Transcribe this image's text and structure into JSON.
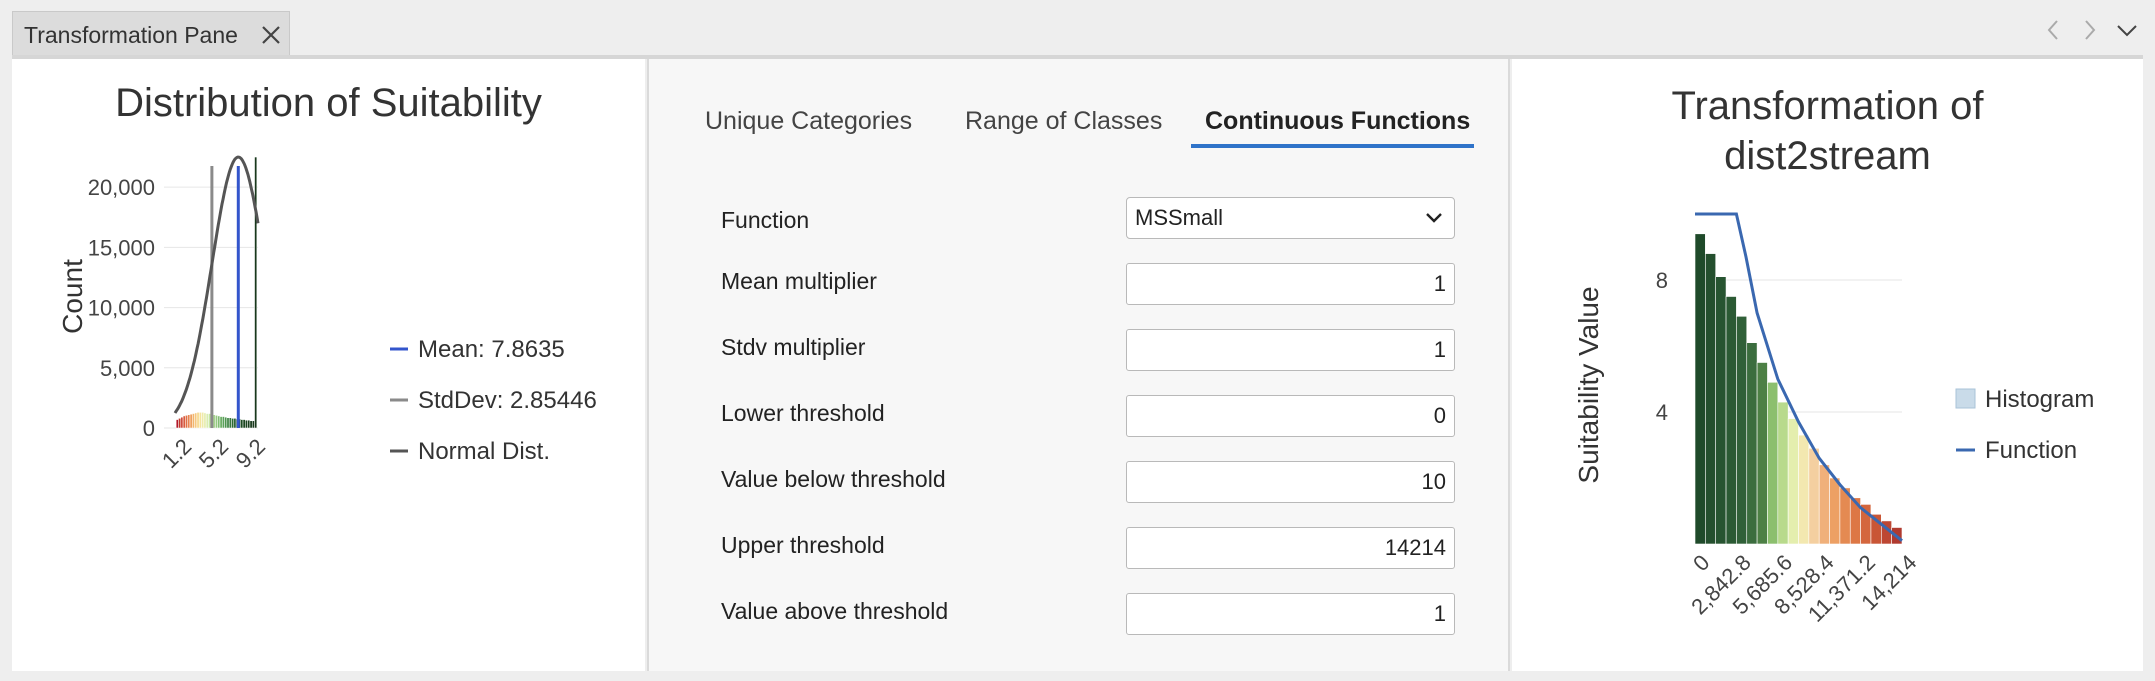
{
  "tab": {
    "title": "Transformation Pane"
  },
  "left_panel": {
    "title": "Distribution of Suitability",
    "legend": {
      "mean": "Mean: 7.8635",
      "stddev": "StdDev: 2.85446",
      "normal": "Normal Dist."
    },
    "colors": {
      "mean": "#3355cc",
      "stddev": "#8a8a8a",
      "normal": "#555555"
    }
  },
  "tabs": [
    "Unique Categories",
    "Range of Classes",
    "Continuous Functions"
  ],
  "active_tab_index": 2,
  "form": {
    "function_label": "Function",
    "function_value": "MSSmall",
    "fields": [
      {
        "label": "Mean multiplier",
        "value": "1"
      },
      {
        "label": "Stdv multiplier",
        "value": "1"
      },
      {
        "label": "Lower threshold",
        "value": "0"
      },
      {
        "label": "Value below threshold",
        "value": "10"
      },
      {
        "label": "Upper threshold",
        "value": "14214"
      },
      {
        "label": "Value above threshold",
        "value": "1"
      }
    ]
  },
  "right_panel": {
    "title_line1": "Transformation of",
    "title_line2": "dist2stream",
    "legend": {
      "histogram": "Histogram",
      "function": "Function"
    }
  },
  "chart_data": [
    {
      "type": "bar",
      "title": "Distribution of Suitability",
      "ylabel": "Count",
      "xlabel": "",
      "xticks": [
        "1.2",
        "5.2",
        "9.2"
      ],
      "yticks": [
        "0",
        "5,000",
        "10,000",
        "15,000",
        "20,000"
      ],
      "ylim": [
        0,
        23500
      ],
      "xlim": [
        1,
        10
      ],
      "bar_x": [
        1.25,
        1.5,
        1.75,
        2.0,
        2.25,
        2.5,
        2.75,
        3.0,
        3.25,
        3.5,
        3.75,
        4.0,
        4.25,
        4.5,
        4.75,
        5.0,
        5.25,
        5.5,
        5.75,
        6.0,
        6.25,
        6.5,
        6.75,
        7.0,
        7.25,
        7.5,
        7.75,
        8.0,
        8.25,
        8.5,
        8.75,
        9.0,
        9.25,
        9.5,
        9.75
      ],
      "values": [
        700,
        800,
        900,
        1000,
        1050,
        1100,
        1150,
        1200,
        1250,
        1300,
        1300,
        1300,
        1250,
        1200,
        1200,
        1150,
        1100,
        1050,
        1000,
        950,
        950,
        900,
        850,
        850,
        800,
        800,
        750,
        750,
        700,
        700,
        650,
        650,
        600,
        600,
        22500
      ],
      "bar_colors": [
        "#b2182b",
        "#c0392b",
        "#cd4a3b",
        "#d85a3f",
        "#e07045",
        "#e8844f",
        "#eea05f",
        "#f2b56d",
        "#f5c87e",
        "#f6d88e",
        "#f4e49e",
        "#efeaa9",
        "#e6edb0",
        "#d9ecb0",
        "#c9e6a6",
        "#b9de9a",
        "#a7d48d",
        "#94c980",
        "#80bd73",
        "#6daf66",
        "#5ba15a",
        "#4c934f",
        "#3f8545",
        "#35773c",
        "#2c6b34",
        "#255f2e",
        "#215628",
        "#1f5025",
        "#1d4b23",
        "#1c4621",
        "#1b4220",
        "#1a3f1f",
        "#1a3c1e",
        "#193a1d",
        "#19381c"
      ],
      "mean": 7.8635,
      "stddev": 2.85446,
      "stddev_line_x": 5.0,
      "normal_curve": {
        "peak": 22500
      },
      "legend": [
        "Mean: 7.8635",
        "StdDev: 2.85446",
        "Normal Dist."
      ]
    },
    {
      "type": "bar",
      "title": "Transformation of dist2stream",
      "ylabel": "Suitability Value",
      "xlabel": "",
      "xticks": [
        "0",
        "2,842.8",
        "5,685.6",
        "8,528.4",
        "11,371.2",
        "14,214"
      ],
      "yticks": [
        "4",
        "8"
      ],
      "xlim": [
        0,
        14214
      ],
      "ylim": [
        0,
        10
      ],
      "histogram": {
        "bin_width": 710.7,
        "values": [
          9.4,
          8.8,
          8.1,
          7.5,
          6.9,
          6.1,
          5.5,
          4.9,
          4.3,
          3.8,
          3.3,
          2.9,
          2.4,
          2.0,
          1.7,
          1.4,
          1.2,
          0.9,
          0.7,
          0.5
        ],
        "colors": [
          "#1f4a2a",
          "#244f2e",
          "#275431",
          "#2b5a34",
          "#306038",
          "#3b6d3e",
          "#4d8045",
          "#8cbf6e",
          "#b8da8c",
          "#e4eeae",
          "#f3e8b0",
          "#f4cfa0",
          "#f0b07a",
          "#eda064",
          "#e48a52",
          "#dd7745",
          "#d4663d",
          "#c95636",
          "#bd4733",
          "#b03a2f"
        ]
      },
      "function_points": [
        [
          0,
          10
        ],
        [
          2842.8,
          10
        ],
        [
          3500,
          8.7
        ],
        [
          4264,
          7.0
        ],
        [
          5685.6,
          5.0
        ],
        [
          7107,
          3.7
        ],
        [
          8528.4,
          2.6
        ],
        [
          9950,
          1.8
        ],
        [
          11371.2,
          1.1
        ],
        [
          12792,
          0.6
        ],
        [
          14214,
          0.1
        ]
      ],
      "series": [
        {
          "name": "Histogram"
        },
        {
          "name": "Function"
        }
      ],
      "legend": [
        "Histogram",
        "Function"
      ]
    }
  ]
}
